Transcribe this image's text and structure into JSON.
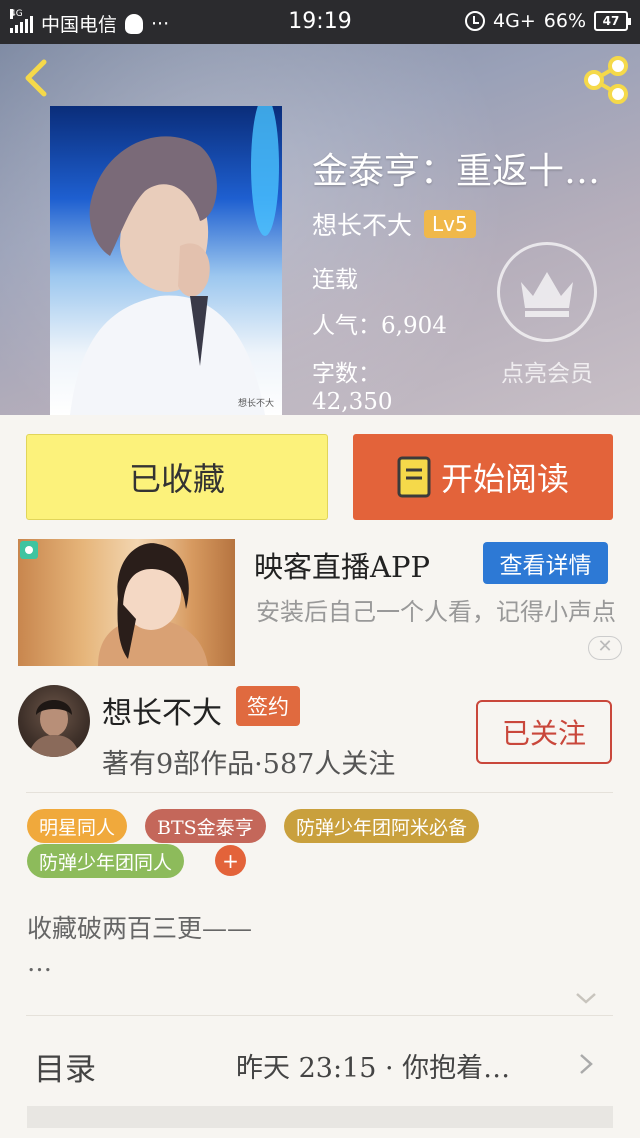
{
  "status_bar": {
    "net_badge": "4G",
    "carrier": "中国电信",
    "dots": "···",
    "time": "19:19",
    "network": "4G+",
    "battery_percent": "66%",
    "battery_level": "47"
  },
  "book": {
    "title": "金泰亨：重返十…",
    "author": "想长不大",
    "author_level": "Lv5",
    "status": "连载",
    "popularity": "人气：6,904",
    "word_count_label": "字数：",
    "word_count": "42,350",
    "cover_watermark": "想长不大"
  },
  "vip": {
    "label": "点亮会员"
  },
  "actions": {
    "collect_label": "已收藏",
    "read_label": "开始阅读"
  },
  "ad": {
    "title": "映客直播APP",
    "detail_button": "查看详情",
    "description": "安装后自己一个人看，记得小声点",
    "close": "✕"
  },
  "author_card": {
    "name": "想长不大",
    "badge": "签约",
    "stats": "著有9部作品·587人关注",
    "follow_label": "已关注"
  },
  "tags": [
    {
      "label": "明星同人",
      "color": "#f0a93c"
    },
    {
      "label": "BTS金泰亨",
      "color": "#c4675a"
    },
    {
      "label": "防弹少年团阿米必备",
      "color": "#c9a03d"
    },
    {
      "label": "防弹少年团同人",
      "color": "#8dbb5b"
    }
  ],
  "tag_add": "+",
  "description": {
    "line1": "收藏破两百三更——",
    "line2": "…"
  },
  "toc": {
    "label": "目录",
    "latest": "昨天 23:15 · 你抱着…"
  },
  "colors": {
    "read_button": "#e3633a",
    "collect_button": "#fcf27b",
    "ad_button": "#2d79d5",
    "follow_border": "#c9473b",
    "level_badge": "#f0b84a"
  }
}
